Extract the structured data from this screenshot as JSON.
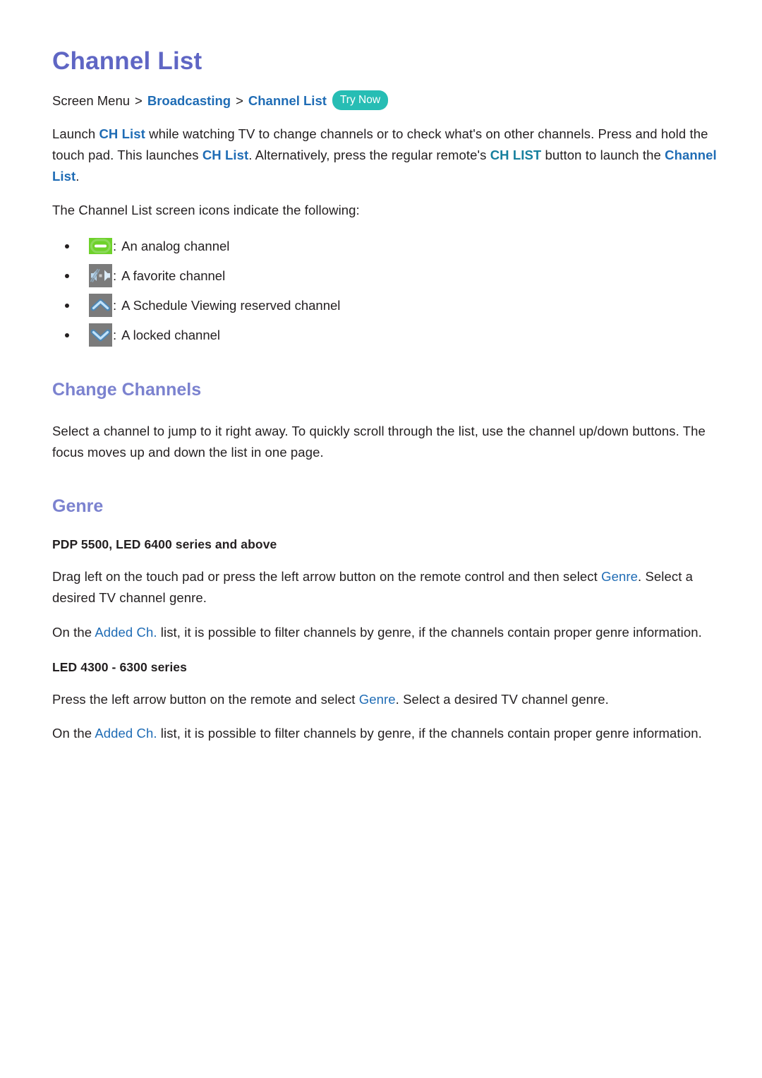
{
  "document": {
    "title": "Channel List"
  },
  "breadcrumb": {
    "root": "Screen Menu",
    "separator": ">",
    "level1": "Broadcasting",
    "level2": "Channel List",
    "badge": "Try Now"
  },
  "intro": {
    "p1_part1": "Launch ",
    "p1_link1": "CH List",
    "p1_part2": " while watching TV to change channels or to check what's on other channels. Press and hold the touch pad. This launches ",
    "p1_link2": "CH List",
    "p1_part3": ". Alternatively, press the regular remote's ",
    "p1_link3": "CH LIST",
    "p1_part4": " button to launch the ",
    "p1_link4": "Channel List",
    "p1_part5": ".",
    "p2": "The Channel List screen icons indicate the following:"
  },
  "icon_list": [
    {
      "icon": "analog-channel-icon",
      "separator": ":",
      "label": "An analog channel",
      "color": "#6ed12a"
    },
    {
      "icon": "favorite-channel-icon",
      "separator": ":",
      "label": "A favorite channel",
      "color": "#7b7b7b"
    },
    {
      "icon": "schedule-viewing-icon",
      "separator": ":",
      "label": "A Schedule Viewing reserved channel",
      "color": "#7b7b7b"
    },
    {
      "icon": "locked-channel-icon",
      "separator": ":",
      "label": "A locked channel",
      "color": "#7b7b7b"
    }
  ],
  "change_channels": {
    "heading": "Change Channels",
    "body": "Select a channel to jump to it right away. To quickly scroll through the list, use the channel up/down buttons. The focus moves up and down the list in one page."
  },
  "genre": {
    "heading": "Genre",
    "sub1": "PDP 5500, LED 6400 series and above",
    "p1_part1": "Drag left on the touch pad or press the left arrow button on the remote control and then select ",
    "p1_link": "Genre",
    "p1_part2": ". Select a desired TV channel genre.",
    "p2_part1": "On the ",
    "p2_link": "Added Ch.",
    "p2_part2": " list, it is possible to filter channels by genre, if the channels contain proper genre information.",
    "sub2": "LED 4300 - 6300 series",
    "p3_part1": "Press the left arrow button on the remote and select ",
    "p3_link": "Genre",
    "p3_part2": ". Select a desired TV channel genre.",
    "p4_part1": "On the ",
    "p4_link": "Added Ch.",
    "p4_part2": " list, it is possible to filter channels by genre, if the channels contain proper genre information."
  },
  "colors": {
    "title_purple": "#5f66c4",
    "heading_purple": "#7b82cf",
    "link_blue": "#1f6cb5",
    "link_teal": "#17809e",
    "badge_teal": "#27bdb4",
    "icon_green": "#6ed12a",
    "icon_gray": "#7b7b7b",
    "icon_blue": "#2a8fe0",
    "text": "#231f20"
  }
}
